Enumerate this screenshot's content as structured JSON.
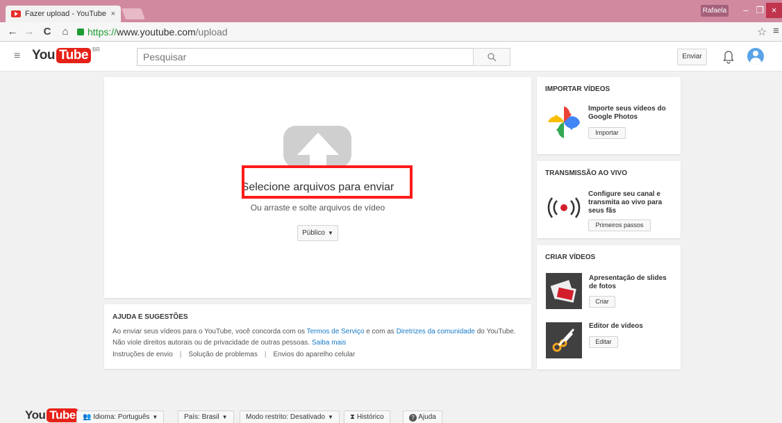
{
  "browser": {
    "tab_title": "Fazer upload - YouTube",
    "tab_close": "×",
    "user": "Rafaela",
    "url_https": "https://",
    "url_host": "www.youtube.com",
    "url_path": "/upload",
    "minimize": "–",
    "maximize": "❐",
    "close": "×"
  },
  "header": {
    "logo_you": "You",
    "logo_tube": "Tube",
    "logo_region": "BR",
    "search_placeholder": "Pesquisar",
    "upload_label": "Enviar"
  },
  "upload": {
    "title": "Selecione arquivos para enviar",
    "subtitle": "Ou arraste e solte arquivos de vídeo",
    "privacy": "Público"
  },
  "help": {
    "title": "AJUDA E SUGESTÕES",
    "line1_a": "Ao enviar seus vídeos para o YouTube, você concorda com os ",
    "terms_link": "Termos de Serviço",
    "line1_b": " e com as ",
    "guidelines_link": "Diretrizes da comunidade",
    "line1_c": " do YouTube.",
    "line2": "Não viole direitos autorais ou de privacidade de outras pessoas. ",
    "learn_more": "Saiba mais",
    "links": [
      "Instruções de envio",
      "Solução de problemas",
      "Envios do aparelho celular"
    ]
  },
  "import": {
    "title": "IMPORTAR VÍDEOS",
    "desc": "Importe seus vídeos do Google Photos",
    "button": "Importar"
  },
  "live": {
    "title": "TRANSMISSÃO AO VIVO",
    "desc": "Configure seu canal e transmita ao vivo para seus fãs",
    "button": "Primeiros passos"
  },
  "create": {
    "title": "CRIAR VÍDEOS",
    "slideshow_desc": "Apresentação de slides de fotos",
    "slideshow_button": "Criar",
    "editor_desc": "Editor de vídeos",
    "editor_button": "Editar"
  },
  "footer": {
    "language": "Idioma: Português",
    "country": "País: Brasil",
    "restricted": "Modo restrito: Desativado",
    "history": "Histórico",
    "help": "Ajuda"
  }
}
